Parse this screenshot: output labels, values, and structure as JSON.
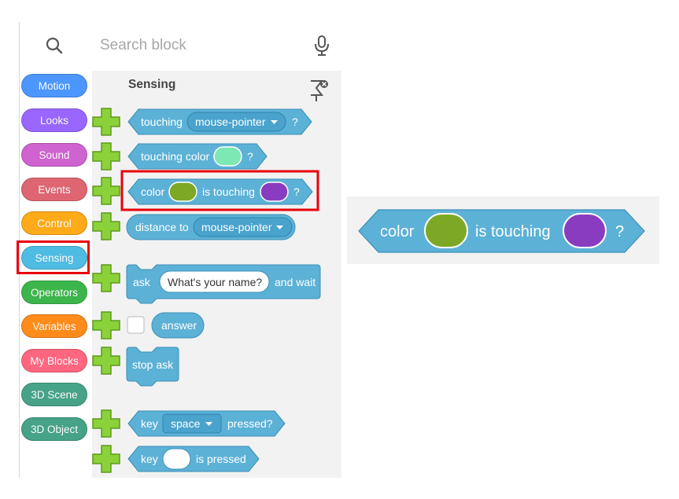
{
  "search": {
    "placeholder": "Search block"
  },
  "categories": [
    {
      "label": "Motion",
      "color": "#4C97FF"
    },
    {
      "label": "Looks",
      "color": "#9966FF"
    },
    {
      "label": "Sound",
      "color": "#CF63CF"
    },
    {
      "label": "Events",
      "color": "#DE6673"
    },
    {
      "label": "Control",
      "color": "#FFAB19"
    },
    {
      "label": "Sensing",
      "color": "#4FBCE3"
    },
    {
      "label": "Operators",
      "color": "#3CB64C"
    },
    {
      "label": "Variables",
      "color": "#FF8C1A"
    },
    {
      "label": "My Blocks",
      "color": "#FF6680"
    },
    {
      "label": "3D Scene",
      "color": "#46A388"
    },
    {
      "label": "3D Object",
      "color": "#46A388"
    }
  ],
  "palette": {
    "section_title": "Sensing",
    "block_color": "#5CB1D6",
    "blocks": {
      "touching": {
        "label": "touching",
        "dropdown": "mouse-pointer",
        "suffix": "?"
      },
      "touching_color": {
        "label": "touching color",
        "swatch": "#7CE8B4",
        "suffix": "?"
      },
      "color_touching": {
        "label1": "color",
        "swatch1": "#7DA825",
        "label2": "is touching",
        "swatch2": "#8A3CC0",
        "suffix": "?"
      },
      "distance": {
        "label": "distance to",
        "dropdown": "mouse-pointer"
      },
      "ask": {
        "label": "ask",
        "input": "What's your name?",
        "suffix": "and wait"
      },
      "answer": {
        "label": "answer"
      },
      "stop_ask": {
        "label": "stop ask"
      },
      "key_pressed": {
        "label": "key",
        "dropdown": "space",
        "suffix": "pressed?"
      },
      "key_is_pressed": {
        "label": "key",
        "suffix": "is pressed"
      }
    }
  },
  "zoom": {
    "label1": "color",
    "label2": "is touching",
    "suffix": "?"
  },
  "highlight_color": "#E8000B"
}
